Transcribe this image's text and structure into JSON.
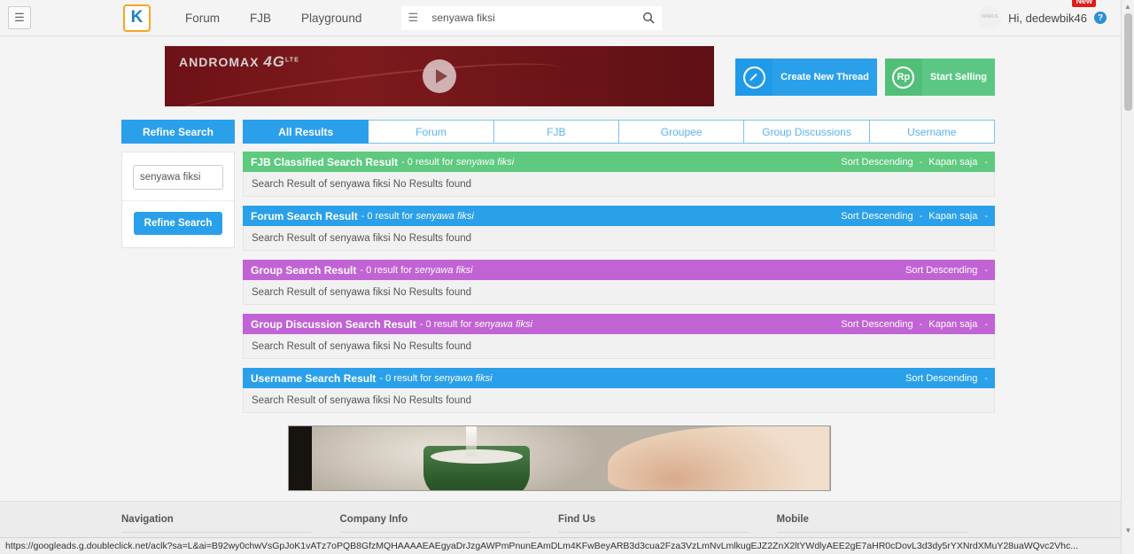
{
  "topbar": {
    "menu_icon": "hamburger-icon",
    "logo_text": "K",
    "nav": [
      {
        "label": "Forum"
      },
      {
        "label": "FJB"
      },
      {
        "label": "Playground"
      }
    ],
    "search": {
      "menu_icon": "hamburger-icon",
      "value": "senyawa fiksi",
      "placeholder": "Search",
      "submit_icon": "search-icon"
    },
    "user": {
      "avatar_text": "KASKUS",
      "greeting": "Hi, dedewbik46",
      "badge": "New",
      "help_icon": "question-mark-icon"
    }
  },
  "ad_top": {
    "brand": "ANDROMAX",
    "brand_suffix": "4G",
    "brand_small": "LTE",
    "play_icon": "play-icon"
  },
  "actions": [
    {
      "icon": "pencil-icon",
      "icon_glyph": "✎",
      "label": "Create New Thread",
      "color": "#2aa0ea"
    },
    {
      "icon": "rupiah-icon",
      "icon_glyph": "Rp",
      "label": "Start Selling",
      "color": "#5cc785"
    }
  ],
  "refine_tab_label": "Refine Search",
  "tabs": [
    {
      "label": "All Results",
      "active": true
    },
    {
      "label": "Forum",
      "active": false
    },
    {
      "label": "FJB",
      "active": false
    },
    {
      "label": "Groupee",
      "active": false
    },
    {
      "label": "Group Discussions",
      "active": false
    },
    {
      "label": "Username",
      "active": false
    }
  ],
  "sidebar": {
    "input_value": "senyawa fiksi",
    "input_placeholder": "Search",
    "button_label": "Refine Search"
  },
  "query": "senyawa fiksi",
  "panels": [
    {
      "title": "FJB Classified Search Result",
      "sub_prefix": "- 0 result for",
      "query": "senyawa fiksi",
      "color": "c-green",
      "sort_label": "Sort Descending",
      "time_label": "Kapan saja",
      "has_time": true,
      "body": "Search Result of senyawa fiksi No Results found"
    },
    {
      "title": "Forum Search Result",
      "sub_prefix": "- 0 result for",
      "query": "senyawa fiksi",
      "color": "c-blue",
      "sort_label": "Sort Descending",
      "time_label": "Kapan saja",
      "has_time": true,
      "body": "Search Result of senyawa fiksi No Results found"
    },
    {
      "title": "Group Search Result",
      "sub_prefix": "- 0 result for",
      "query": "senyawa fiksi",
      "color": "c-purple",
      "sort_label": "Sort Descending",
      "time_label": "",
      "has_time": false,
      "body": "Search Result of senyawa fiksi No Results found"
    },
    {
      "title": "Group Discussion Search Result",
      "sub_prefix": "- 0 result for",
      "query": "senyawa fiksi",
      "color": "c-purple",
      "sort_label": "Sort Descending",
      "time_label": "Kapan saja",
      "has_time": true,
      "body": "Search Result of senyawa fiksi No Results found"
    },
    {
      "title": "Username Search Result",
      "sub_prefix": "- 0 result for",
      "query": "senyawa fiksi",
      "color": "c-blue",
      "sort_label": "Sort Descending",
      "time_label": "",
      "has_time": false,
      "body": "Search Result of senyawa fiksi No Results found"
    }
  ],
  "footer": {
    "columns": [
      {
        "title": "Navigation"
      },
      {
        "title": "Company Info"
      },
      {
        "title": "Find Us"
      },
      {
        "title": "Mobile"
      }
    ]
  },
  "statusbar": {
    "url": "https://googleads.g.doubleclick.net/aclk?sa=L&ai=B92wy0chwVsGpJoK1vATz7oPQB8GfzMQHAAAAEAEgyaDrJzgAWPmPnunEAmDLm4KFwBeyARB3d3cua2Fza3VzLmNvLmlkugEJZ2ZnX2ltYWdlyAEE2gE7aHR0cDovL3d3dy5rYXNrdXMuY28uaWQvc2Vhc..."
  }
}
